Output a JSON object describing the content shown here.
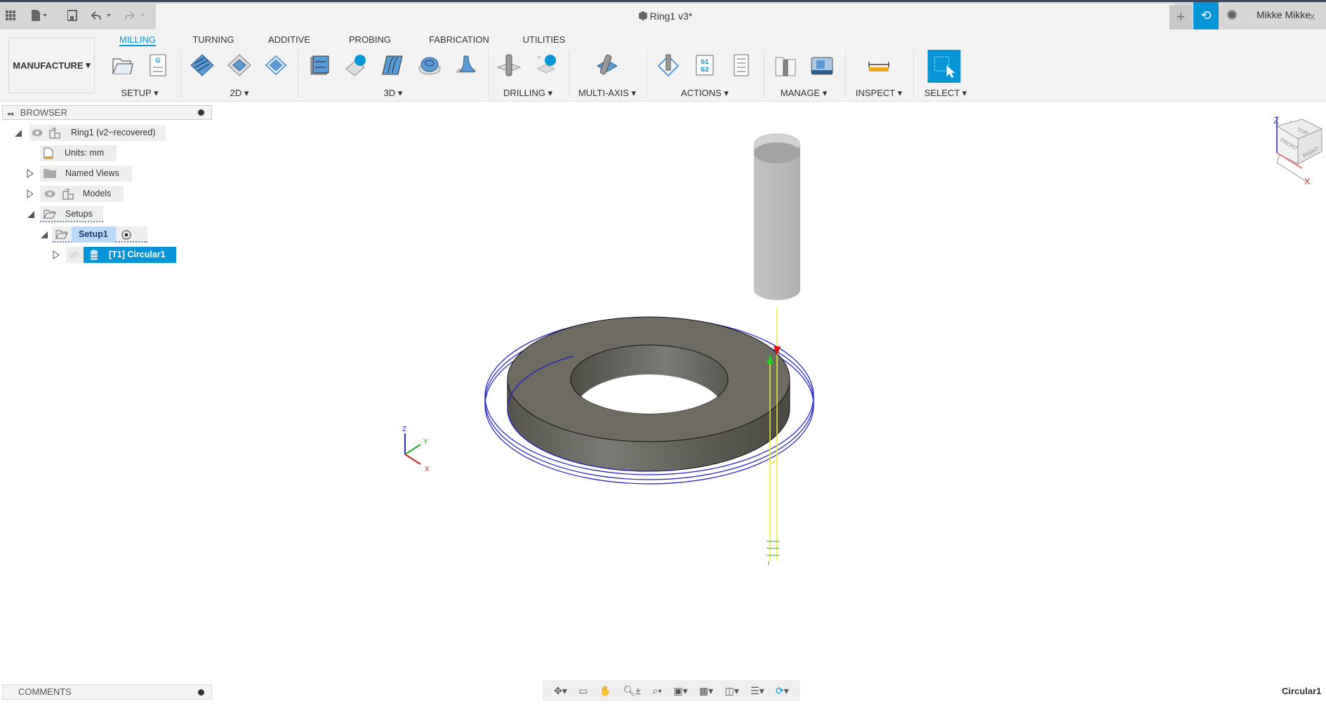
{
  "title_bar": {
    "document_title": "Ring1 v3*",
    "close_tab": "x",
    "new_tab": "+",
    "user_name": "Mikke Mikke"
  },
  "workspace": {
    "label": "MANUFACTURE"
  },
  "tabs": [
    {
      "label": "MILLING",
      "active": true
    },
    {
      "label": "TURNING"
    },
    {
      "label": "ADDITIVE"
    },
    {
      "label": "PROBING"
    },
    {
      "label": "FABRICATION"
    },
    {
      "label": "UTILITIES"
    }
  ],
  "groups": [
    "SETUP ▾",
    "2D ▾",
    "3D ▾",
    "DRILLING ▾",
    "MULTI-AXIS ▾",
    "ACTIONS ▾",
    "MANAGE ▾",
    "INSPECT ▾",
    "SELECT ▾"
  ],
  "actions_icon_text": "G1\nG2",
  "browser": {
    "title": "BROWSER",
    "items": [
      {
        "label": "Ring1 (v2~recovered)"
      },
      {
        "label": "Units: mm"
      },
      {
        "label": "Named Views"
      },
      {
        "label": "Models"
      },
      {
        "label": "Setups"
      },
      {
        "label": "Setup1"
      },
      {
        "label": "[T1] Circular1",
        "selected": true
      }
    ]
  },
  "comments": {
    "title": "COMMENTS"
  },
  "viewcube": {
    "top": "TOP",
    "front": "FRONT",
    "right": "RIGHT",
    "z": "Z",
    "x": "X"
  },
  "triad": {
    "z": "Z",
    "y": "Y",
    "x": "X"
  },
  "status": {
    "text": "Circular1"
  },
  "colors": {
    "accent": "#0696d7",
    "toolpath": "#1a1acc",
    "part": "#6b6a62",
    "tool": "#bdbdbd",
    "lead": "#ffff33"
  }
}
